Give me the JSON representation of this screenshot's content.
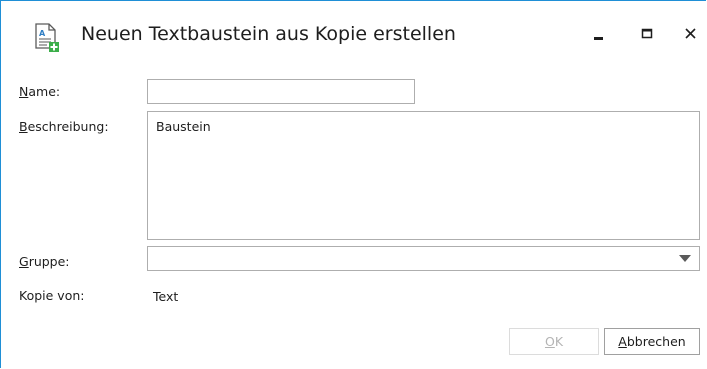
{
  "window": {
    "title": "Neuen Textbaustein aus Kopie erstellen",
    "icon": "document-add-icon",
    "controls": {
      "minimize": "minimize-icon",
      "maximize": "maximize-icon",
      "close": "close-icon"
    }
  },
  "form": {
    "name": {
      "label_accel": "N",
      "label_rest": "ame:",
      "value": ""
    },
    "description": {
      "label_accel": "B",
      "label_rest": "eschreibung:",
      "value": "Baustein"
    },
    "group": {
      "label_accel": "G",
      "label_rest": "ruppe:",
      "value": ""
    },
    "copy_of": {
      "label": "Kopie von:",
      "value": "Text"
    }
  },
  "buttons": {
    "ok": {
      "accel": "O",
      "rest": "K",
      "enabled": false
    },
    "cancel": {
      "accel": "A",
      "rest": "bbrechen",
      "enabled": true
    }
  },
  "colors": {
    "window_border": "#1f8fd6",
    "icon_green": "#3cae4a",
    "icon_blue": "#2f7ec4"
  }
}
